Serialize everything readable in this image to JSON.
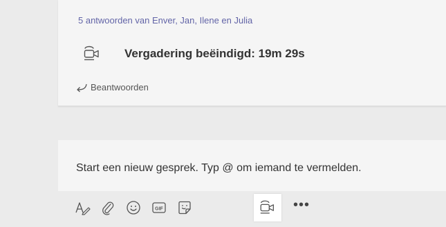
{
  "thread": {
    "replies_summary": "5 antwoorden van Enver, Jan, Ilene en Julia",
    "meeting_status": "Vergadering beëindigd: 19m 29s",
    "reply_label": "Beantwoorden"
  },
  "compose": {
    "placeholder": "Start een nieuw gesprek. Typ @ om iemand te vermelden."
  },
  "toolbar": {
    "tools": [
      "format-icon",
      "attach-icon",
      "emoji-icon",
      "gif-icon",
      "sticker-icon",
      "meet-now-icon",
      "more-options-icon"
    ],
    "gif_label": "GIF",
    "more_label": "•••",
    "active_tool": "meet-now-icon"
  },
  "colors": {
    "accent": "#6264a7",
    "background": "#ebebeb",
    "card": "#f5f5f5"
  }
}
